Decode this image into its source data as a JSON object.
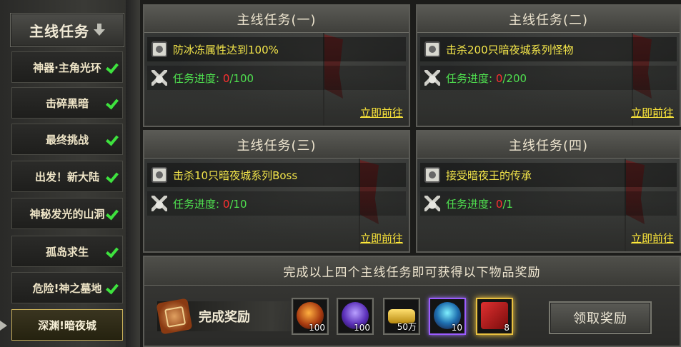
{
  "sidebar": {
    "header": "主线任务",
    "items": [
      {
        "label": "神器·主角光环",
        "done": true
      },
      {
        "label": "击碎黑暗",
        "done": true
      },
      {
        "label": "最终挑战",
        "done": true
      },
      {
        "label": "出发！新大陆",
        "done": true
      },
      {
        "label": "神秘发光的山洞",
        "done": true
      },
      {
        "label": "孤岛求生",
        "done": true
      },
      {
        "label": "危险!神之墓地",
        "done": true
      },
      {
        "label": "深渊!暗夜城",
        "done": false,
        "active": true
      }
    ]
  },
  "tasks": [
    {
      "title": "主线任务(一)",
      "goal": "防冰冻属性达到100%",
      "progress_label": "任务进度: ",
      "current": "0",
      "total": "/100",
      "go": "立即前往"
    },
    {
      "title": "主线任务(二)",
      "goal": "击杀200只暗夜城系列怪物",
      "progress_label": "任务进度: ",
      "current": "0",
      "total": "/200",
      "go": "立即前往"
    },
    {
      "title": "主线任务(三)",
      "goal": "击杀10只暗夜城系列Boss",
      "progress_label": "任务进度: ",
      "current": "0",
      "total": "/10",
      "go": "立即前往"
    },
    {
      "title": "主线任务(四)",
      "goal": "接受暗夜王的传承",
      "progress_label": "任务进度: ",
      "current": "0",
      "total": "/1",
      "go": "立即前往"
    }
  ],
  "reward": {
    "header": "完成以上四个主线任务即可获得以下物品奖励",
    "tag": "完成奖励",
    "items": [
      {
        "icon": "orb-flame-icon",
        "count": "100"
      },
      {
        "icon": "purple-crystal-icon",
        "count": "100"
      },
      {
        "icon": "gold-coins-icon",
        "count": "50万"
      },
      {
        "icon": "blue-gem-icon",
        "count": "10"
      },
      {
        "icon": "red-tome-icon",
        "count": "8"
      }
    ],
    "claim": "领取奖励"
  }
}
